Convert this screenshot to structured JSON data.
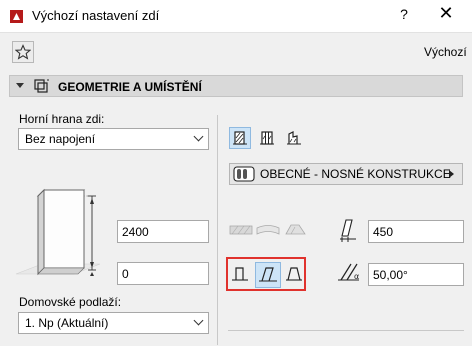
{
  "window": {
    "title": "Výchozí nastavení zdí",
    "help_label": "?",
    "close_label": "✕"
  },
  "header": {
    "favorites_icon": "star-icon",
    "right_label": "Výchozí"
  },
  "section": {
    "title": "GEOMETRIE A UMÍSTĚNÍ",
    "icon": "geometry-icon"
  },
  "left": {
    "top_edge_label": "Horní hrana zdi:",
    "top_edge_value": "Bez napojení",
    "height_value": "2400",
    "offset_value": "0",
    "home_story_label": "Domovské podlaží:",
    "home_story_value": "1. Np (Aktuální)"
  },
  "right": {
    "structure_buttons": [
      "basic-wall-icon",
      "composite-wall-icon",
      "profile-wall-icon"
    ],
    "type_label": "OBECNÉ - NOSNÉ KONSTRUKCE",
    "thickness_value": "450",
    "angle_value": "50,00°",
    "geometry_buttons": [
      "straight-wall-icon",
      "slanted-wall-icon",
      "trapezoid-wall-icon"
    ]
  },
  "colors": {
    "selected_bg": "#cde4f7",
    "highlight_border": "#e0322d",
    "section_bg": "#d9d9d9"
  }
}
